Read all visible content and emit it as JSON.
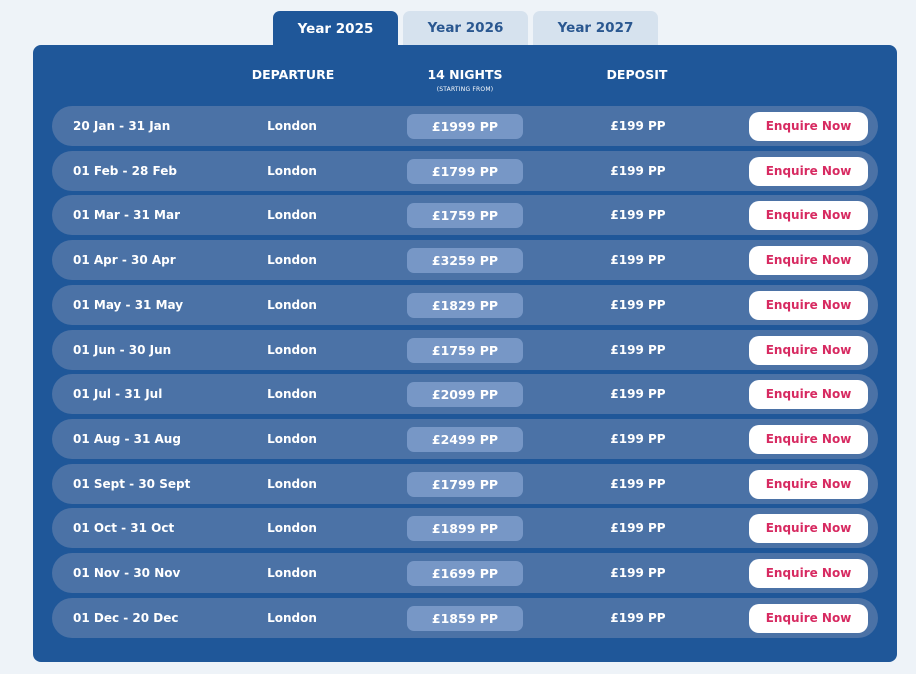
{
  "tabs": [
    {
      "label": "Year 2025",
      "active": true
    },
    {
      "label": "Year 2026",
      "active": false
    },
    {
      "label": "Year 2027",
      "active": false
    }
  ],
  "headers": {
    "departure": "DEPARTURE",
    "nights": "14 NIGHTS",
    "nights_sub": "(STARTING FROM)",
    "deposit": "DEPOSIT"
  },
  "rows": [
    {
      "dates": "20 Jan - 31 Jan",
      "city": "London",
      "price": "£1999 PP",
      "deposit": "£199 PP",
      "cta": "Enquire Now"
    },
    {
      "dates": "01 Feb - 28 Feb",
      "city": "London",
      "price": "£1799 PP",
      "deposit": "£199 PP",
      "cta": "Enquire Now"
    },
    {
      "dates": "01 Mar - 31 Mar",
      "city": "London",
      "price": "£1759 PP",
      "deposit": "£199 PP",
      "cta": "Enquire Now"
    },
    {
      "dates": "01 Apr - 30 Apr",
      "city": "London",
      "price": "£3259 PP",
      "deposit": "£199 PP",
      "cta": "Enquire Now"
    },
    {
      "dates": "01 May - 31 May",
      "city": "London",
      "price": "£1829 PP",
      "deposit": "£199 PP",
      "cta": "Enquire Now"
    },
    {
      "dates": "01 Jun - 30 Jun",
      "city": "London",
      "price": "£1759 PP",
      "deposit": "£199 PP",
      "cta": "Enquire Now"
    },
    {
      "dates": "01 Jul - 31 Jul",
      "city": "London",
      "price": "£2099 PP",
      "deposit": "£199 PP",
      "cta": "Enquire Now"
    },
    {
      "dates": "01 Aug - 31 Aug",
      "city": "London",
      "price": "£2499 PP",
      "deposit": "£199 PP",
      "cta": "Enquire Now"
    },
    {
      "dates": "01 Sept - 30 Sept",
      "city": "London",
      "price": "£1799 PP",
      "deposit": "£199 PP",
      "cta": "Enquire Now"
    },
    {
      "dates": "01 Oct - 31 Oct",
      "city": "London",
      "price": "£1899 PP",
      "deposit": "£199 PP",
      "cta": "Enquire Now"
    },
    {
      "dates": "01 Nov - 30 Nov",
      "city": "London",
      "price": "£1699 PP",
      "deposit": "£199 PP",
      "cta": "Enquire Now"
    },
    {
      "dates": "01 Dec - 20 Dec",
      "city": "London",
      "price": "£1859 PP",
      "deposit": "£199 PP",
      "cta": "Enquire Now"
    }
  ],
  "colors": {
    "panel": "#1f5799",
    "row": "#4b72a6",
    "price_pill": "#7797c6",
    "cta_text": "#d72a61",
    "tab_inactive": "#d6e2ee",
    "tab_inactive_text": "#2a5790"
  }
}
